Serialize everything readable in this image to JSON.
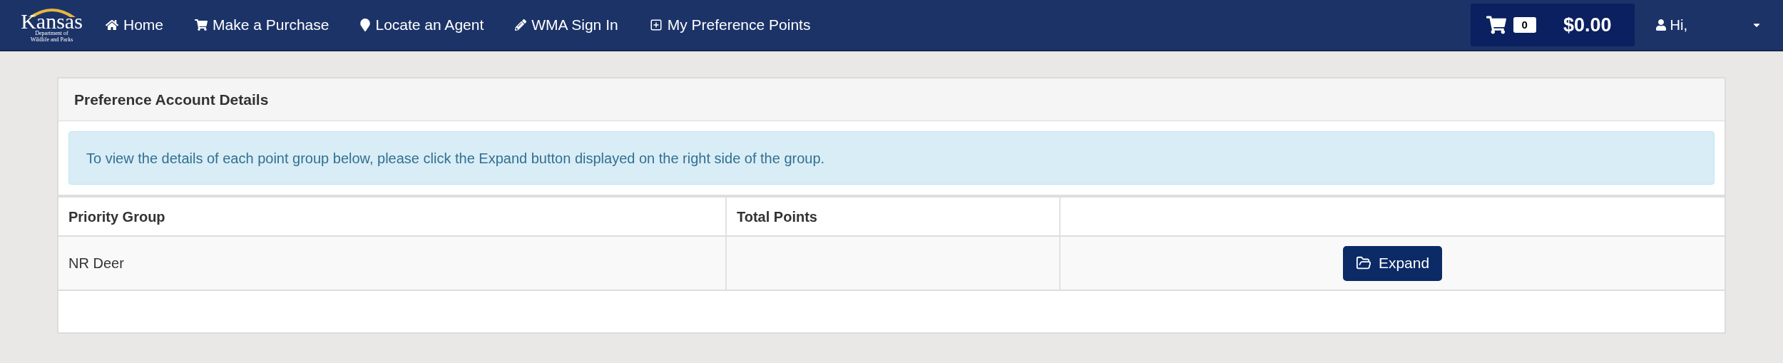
{
  "logo": {
    "name": "Kansas",
    "subtitle_lines": [
      "Department of",
      "Wildlife and Parks"
    ]
  },
  "nav": [
    {
      "label": "Home",
      "kind": "home"
    },
    {
      "label": "Make a Purchase",
      "kind": "purchase"
    },
    {
      "label": "Locate an Agent",
      "kind": "locate"
    },
    {
      "label": "WMA Sign In",
      "kind": "signin"
    },
    {
      "label": "My Preference Points",
      "kind": "points"
    }
  ],
  "cart": {
    "count": "0",
    "total": "$0.00"
  },
  "user": {
    "greeting": "Hi,"
  },
  "panel": {
    "title": "Preference Account Details",
    "alert": "To view the details of each point group below, please click the Expand button displayed on the right side of the group."
  },
  "table": {
    "columns": [
      "Priority Group",
      "Total Points"
    ],
    "rows": [
      {
        "group": "NR Deer",
        "button": "Expand"
      }
    ]
  }
}
